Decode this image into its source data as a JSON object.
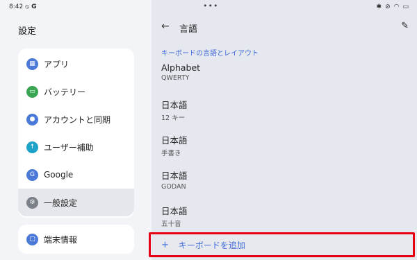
{
  "status": {
    "time": "8:42",
    "left_icons": [
      "vpn-icon",
      "google-icon"
    ],
    "right_icons": [
      "bluetooth-icon",
      "mute-icon",
      "wifi-icon",
      "battery-icon"
    ]
  },
  "settings": {
    "title": "設定",
    "items": [
      {
        "label": "アプリ",
        "color": "#4a79d8"
      },
      {
        "label": "バッテリー",
        "color": "#39a553"
      },
      {
        "label": "アカウントと同期",
        "color": "#4a79d8"
      },
      {
        "label": "ユーザー補助",
        "color": "#1ca3c7"
      },
      {
        "label": "Google",
        "color": "#4a79d8"
      },
      {
        "label": "一般設定",
        "color": "#7b7f87"
      }
    ],
    "device_info": {
      "label": "端末情報",
      "color": "#4a79d8"
    }
  },
  "language": {
    "title": "言語",
    "section_label": "キーボードの言語とレイアウト",
    "keyboards": [
      {
        "name": "Alphabet",
        "layout": "QWERTY"
      },
      {
        "name": "日本語",
        "layout": "12 キー"
      },
      {
        "name": "日本語",
        "layout": "手書き"
      },
      {
        "name": "日本語",
        "layout": "GODAN"
      },
      {
        "name": "日本語",
        "layout": "五十音"
      }
    ],
    "add_keyboard_label": "キーボードを追加"
  },
  "colors": {
    "accent": "#3f6ad8",
    "highlight": "#e60012"
  }
}
